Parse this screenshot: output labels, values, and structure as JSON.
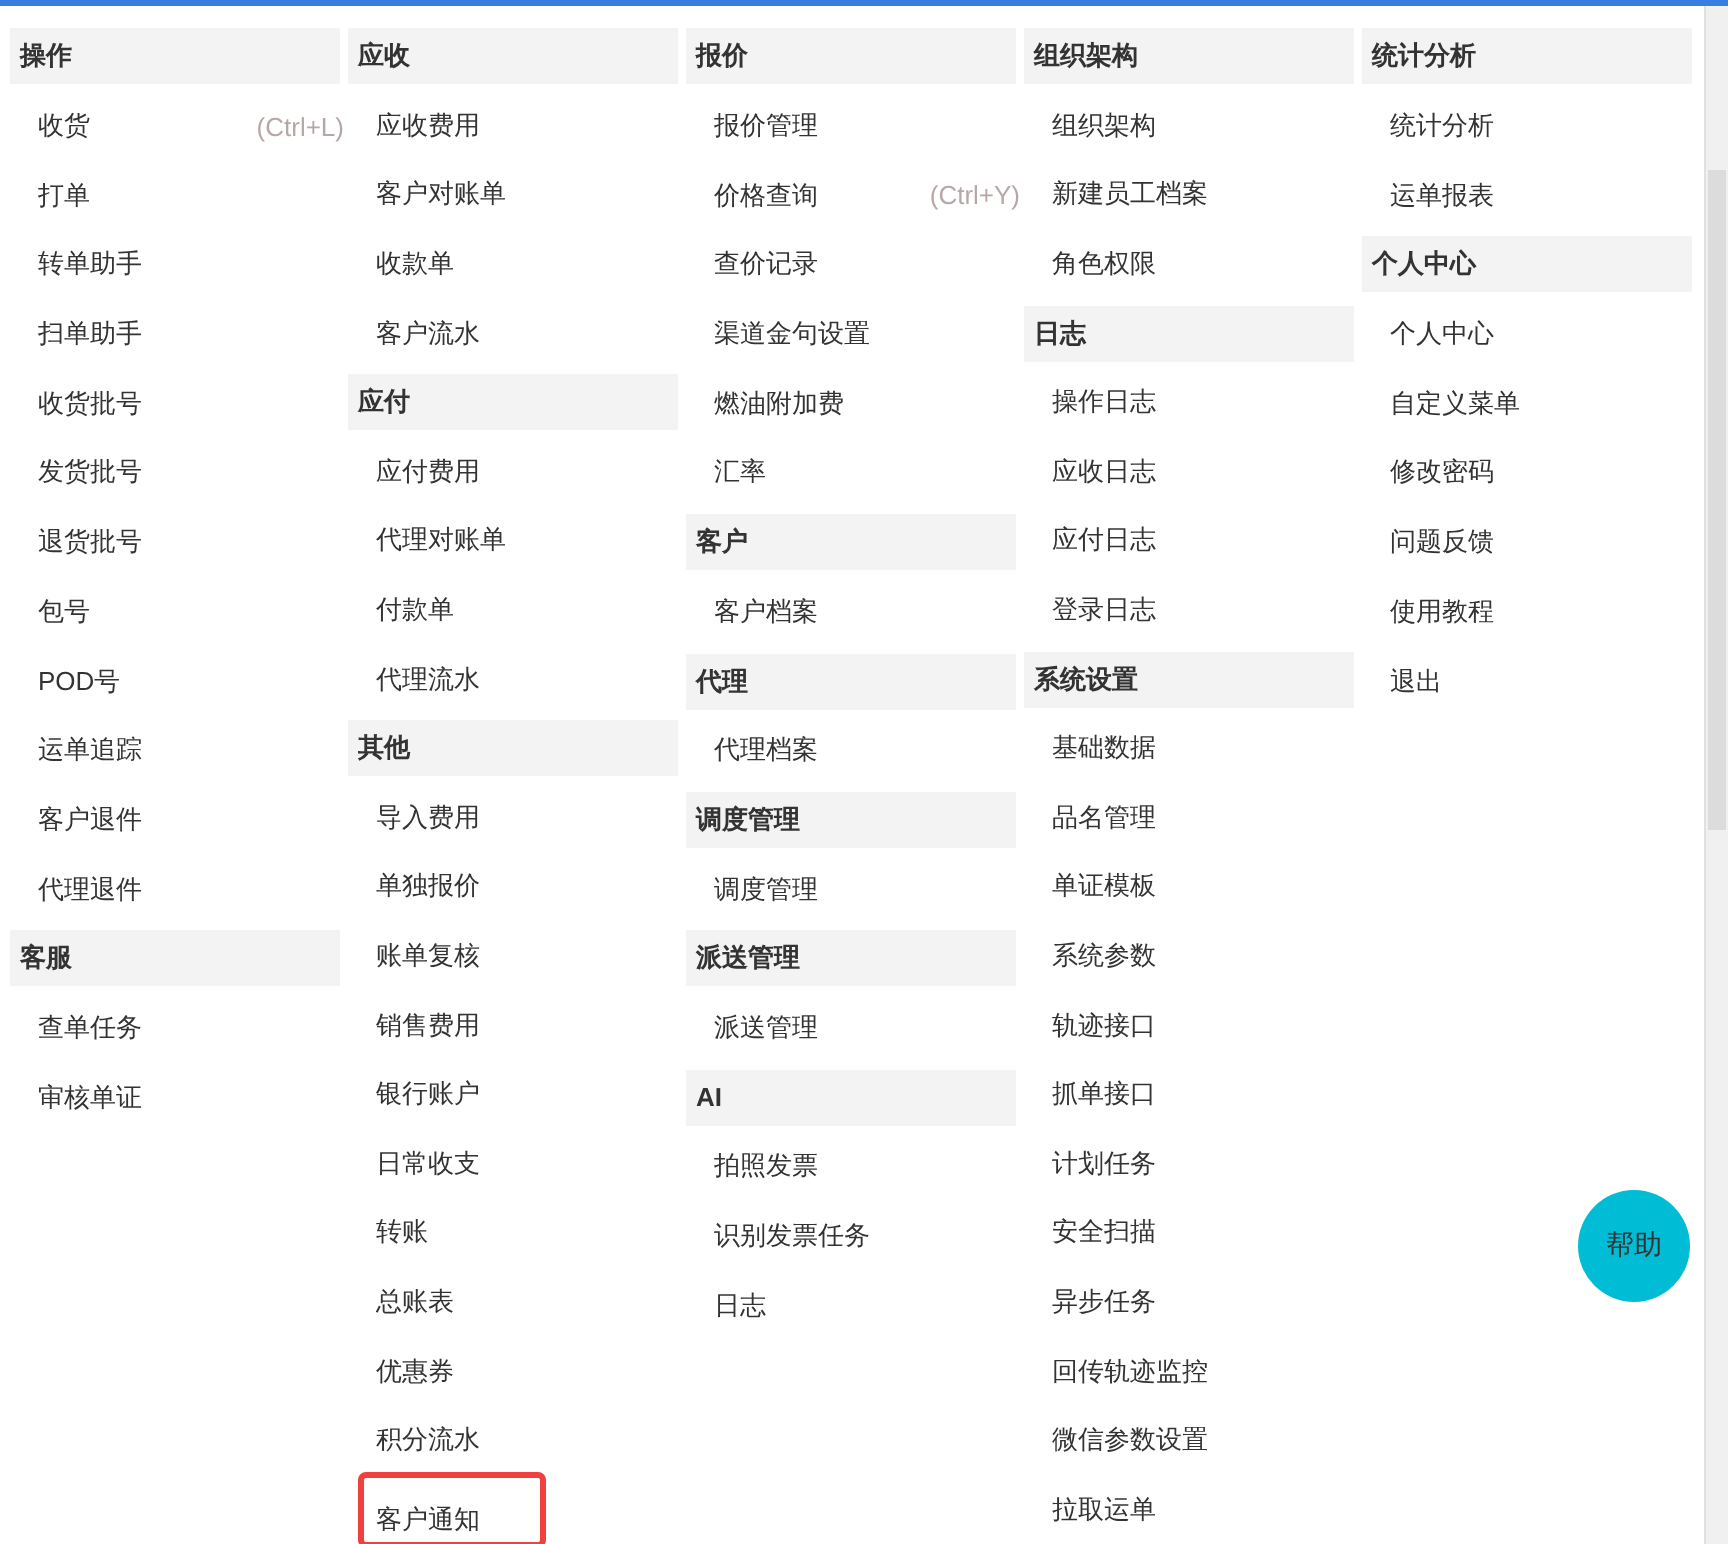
{
  "columns": [
    {
      "sections": [
        {
          "title": "操作",
          "items": [
            {
              "label": "收货",
              "shortcut": "(Ctrl+L)",
              "highlighted": false
            },
            {
              "label": "打单",
              "highlighted": false
            },
            {
              "label": "转单助手",
              "highlighted": false
            },
            {
              "label": "扫单助手",
              "highlighted": false
            },
            {
              "label": "收货批号",
              "highlighted": false
            },
            {
              "label": "发货批号",
              "highlighted": false
            },
            {
              "label": "退货批号",
              "highlighted": false
            },
            {
              "label": "包号",
              "highlighted": false
            },
            {
              "label": "POD号",
              "highlighted": false
            },
            {
              "label": "运单追踪",
              "highlighted": false
            },
            {
              "label": "客户退件",
              "highlighted": false
            },
            {
              "label": "代理退件",
              "highlighted": false
            }
          ]
        },
        {
          "title": "客服",
          "items": [
            {
              "label": "查单任务",
              "highlighted": false
            },
            {
              "label": "审核单证",
              "highlighted": false
            }
          ]
        }
      ]
    },
    {
      "sections": [
        {
          "title": "应收",
          "items": [
            {
              "label": "应收费用",
              "highlighted": false
            },
            {
              "label": "客户对账单",
              "highlighted": false
            },
            {
              "label": "收款单",
              "highlighted": false
            },
            {
              "label": "客户流水",
              "highlighted": false
            }
          ]
        },
        {
          "title": "应付",
          "items": [
            {
              "label": "应付费用",
              "highlighted": false
            },
            {
              "label": "代理对账单",
              "highlighted": false
            },
            {
              "label": "付款单",
              "highlighted": false
            },
            {
              "label": "代理流水",
              "highlighted": false
            }
          ]
        },
        {
          "title": "其他",
          "items": [
            {
              "label": "导入费用",
              "highlighted": false
            },
            {
              "label": "单独报价",
              "highlighted": false
            },
            {
              "label": "账单复核",
              "highlighted": false
            },
            {
              "label": "销售费用",
              "highlighted": false
            },
            {
              "label": "银行账户",
              "highlighted": false
            },
            {
              "label": "日常收支",
              "highlighted": false
            },
            {
              "label": "转账",
              "highlighted": false
            },
            {
              "label": "总账表",
              "highlighted": false
            },
            {
              "label": "优惠券",
              "highlighted": false
            },
            {
              "label": "积分流水",
              "highlighted": false
            },
            {
              "label": "客户通知",
              "highlighted": true
            }
          ]
        }
      ]
    },
    {
      "sections": [
        {
          "title": "报价",
          "items": [
            {
              "label": "报价管理",
              "highlighted": false
            },
            {
              "label": "价格查询",
              "shortcut": "(Ctrl+Y)",
              "highlighted": false
            },
            {
              "label": "查价记录",
              "highlighted": false
            },
            {
              "label": "渠道金句设置",
              "highlighted": false
            },
            {
              "label": "燃油附加费",
              "highlighted": false
            },
            {
              "label": "汇率",
              "highlighted": false
            }
          ]
        },
        {
          "title": "客户",
          "items": [
            {
              "label": "客户档案",
              "highlighted": false
            }
          ]
        },
        {
          "title": "代理",
          "items": [
            {
              "label": "代理档案",
              "highlighted": false
            }
          ]
        },
        {
          "title": "调度管理",
          "items": [
            {
              "label": "调度管理",
              "highlighted": false
            }
          ]
        },
        {
          "title": "派送管理",
          "items": [
            {
              "label": "派送管理",
              "highlighted": false
            }
          ]
        },
        {
          "title": "AI",
          "items": [
            {
              "label": "拍照发票",
              "highlighted": false
            },
            {
              "label": "识别发票任务",
              "highlighted": false
            },
            {
              "label": "日志",
              "highlighted": false
            }
          ]
        }
      ]
    },
    {
      "sections": [
        {
          "title": "组织架构",
          "items": [
            {
              "label": "组织架构",
              "highlighted": false
            },
            {
              "label": "新建员工档案",
              "highlighted": false
            },
            {
              "label": "角色权限",
              "highlighted": false
            }
          ]
        },
        {
          "title": "日志",
          "items": [
            {
              "label": "操作日志",
              "highlighted": false
            },
            {
              "label": "应收日志",
              "highlighted": false
            },
            {
              "label": "应付日志",
              "highlighted": false
            },
            {
              "label": "登录日志",
              "highlighted": false
            }
          ]
        },
        {
          "title": "系统设置",
          "items": [
            {
              "label": "基础数据",
              "highlighted": false
            },
            {
              "label": "品名管理",
              "highlighted": false
            },
            {
              "label": "单证模板",
              "highlighted": false
            },
            {
              "label": "系统参数",
              "highlighted": false
            },
            {
              "label": "轨迹接口",
              "highlighted": false
            },
            {
              "label": "抓单接口",
              "highlighted": false
            },
            {
              "label": "计划任务",
              "highlighted": false
            },
            {
              "label": "安全扫描",
              "highlighted": false
            },
            {
              "label": "异步任务",
              "highlighted": false
            },
            {
              "label": "回传轨迹监控",
              "highlighted": false
            },
            {
              "label": "微信参数设置",
              "highlighted": false
            },
            {
              "label": "拉取运单",
              "highlighted": false
            }
          ]
        }
      ]
    },
    {
      "sections": [
        {
          "title": "统计分析",
          "items": [
            {
              "label": "统计分析",
              "highlighted": false
            },
            {
              "label": "运单报表",
              "highlighted": false
            }
          ]
        },
        {
          "title": "个人中心",
          "items": [
            {
              "label": "个人中心",
              "highlighted": false
            },
            {
              "label": "自定义菜单",
              "highlighted": false
            },
            {
              "label": "修改密码",
              "highlighted": false
            },
            {
              "label": "问题反馈",
              "highlighted": false
            },
            {
              "label": "使用教程",
              "highlighted": false
            },
            {
              "label": "退出",
              "highlighted": false
            }
          ]
        }
      ]
    }
  ],
  "help_button": {
    "label": "帮助"
  }
}
